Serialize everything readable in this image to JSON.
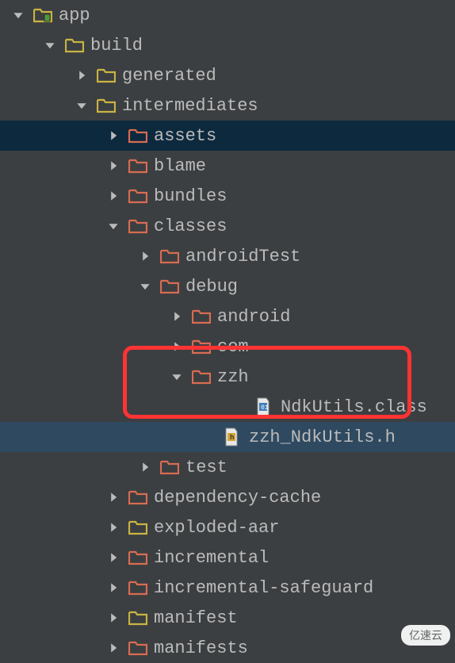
{
  "rows": [
    {
      "indent": 14,
      "arrow": "down",
      "iconType": "module",
      "label": "app"
    },
    {
      "indent": 54,
      "arrow": "down",
      "iconType": "folder-yellow",
      "label": "build"
    },
    {
      "indent": 94,
      "arrow": "right",
      "iconType": "folder-yellow",
      "label": "generated"
    },
    {
      "indent": 94,
      "arrow": "down",
      "iconType": "folder-yellow",
      "label": "intermediates"
    },
    {
      "indent": 134,
      "arrow": "right",
      "iconType": "folder-red",
      "label": "assets",
      "selected": true
    },
    {
      "indent": 134,
      "arrow": "right",
      "iconType": "folder-red",
      "label": "blame"
    },
    {
      "indent": 134,
      "arrow": "right",
      "iconType": "folder-red",
      "label": "bundles"
    },
    {
      "indent": 134,
      "arrow": "down",
      "iconType": "folder-red",
      "label": "classes"
    },
    {
      "indent": 174,
      "arrow": "right",
      "iconType": "folder-red",
      "label": "androidTest"
    },
    {
      "indent": 174,
      "arrow": "down",
      "iconType": "folder-red",
      "label": "debug"
    },
    {
      "indent": 214,
      "arrow": "right",
      "iconType": "folder-red",
      "label": "android"
    },
    {
      "indent": 214,
      "arrow": "right",
      "iconType": "folder-red",
      "label": "com"
    },
    {
      "indent": 214,
      "arrow": "down",
      "iconType": "folder-red",
      "label": "zzh"
    },
    {
      "indent": 294,
      "arrow": "none",
      "iconType": "class-file",
      "label": "NdkUtils.class"
    },
    {
      "indent": 254,
      "arrow": "none",
      "iconType": "h-file",
      "label": "zzh_NdkUtils.h",
      "highlighted": true
    },
    {
      "indent": 174,
      "arrow": "right",
      "iconType": "folder-red",
      "label": "test"
    },
    {
      "indent": 134,
      "arrow": "right",
      "iconType": "folder-red",
      "label": "dependency-cache"
    },
    {
      "indent": 134,
      "arrow": "right",
      "iconType": "folder-yellow",
      "label": "exploded-aar"
    },
    {
      "indent": 134,
      "arrow": "right",
      "iconType": "folder-red",
      "label": "incremental"
    },
    {
      "indent": 134,
      "arrow": "right",
      "iconType": "folder-red",
      "label": "incremental-safeguard"
    },
    {
      "indent": 134,
      "arrow": "right",
      "iconType": "folder-yellow",
      "label": "manifest"
    },
    {
      "indent": 134,
      "arrow": "right",
      "iconType": "folder-red",
      "label": "manifests"
    }
  ],
  "watermark": "亿速云"
}
